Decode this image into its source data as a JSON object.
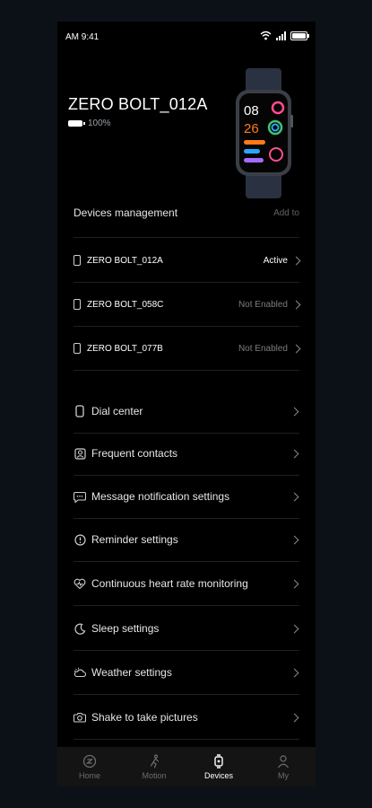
{
  "status_bar": {
    "time": "AM 9:41"
  },
  "device": {
    "name": "ZERO BOLT_012A",
    "battery": "100%"
  },
  "watch_face": {
    "time_top": "08",
    "time_bottom": "26",
    "accent": "#ff7a1a"
  },
  "management": {
    "title": "Devices management",
    "add_label": "Add to"
  },
  "devices": [
    {
      "name": "ZERO BOLT_012A",
      "status": "Active"
    },
    {
      "name": "ZERO BOLT_058C",
      "status": "Not Enabled"
    },
    {
      "name": "ZERO BOLT_077B",
      "status": "Not Enabled"
    }
  ],
  "menu": [
    {
      "label": "Dial center",
      "icon": "watch-icon"
    },
    {
      "label": "Frequent contacts",
      "icon": "contacts-icon"
    },
    {
      "label": "Message notification settings",
      "icon": "message-icon"
    },
    {
      "label": "Reminder settings",
      "icon": "reminder-icon"
    },
    {
      "label": "Continuous heart rate monitoring",
      "icon": "heart-icon"
    },
    {
      "label": "Sleep settings",
      "icon": "moon-icon"
    },
    {
      "label": "Weather settings",
      "icon": "weather-icon"
    },
    {
      "label": "Shake to take pictures",
      "icon": "camera-icon"
    }
  ],
  "tabs": [
    {
      "label": "Home",
      "icon": "home-icon",
      "active": false
    },
    {
      "label": "Motion",
      "icon": "motion-icon",
      "active": false
    },
    {
      "label": "Devices",
      "icon": "watch-icon",
      "active": true
    },
    {
      "label": "My",
      "icon": "person-icon",
      "active": false
    }
  ]
}
